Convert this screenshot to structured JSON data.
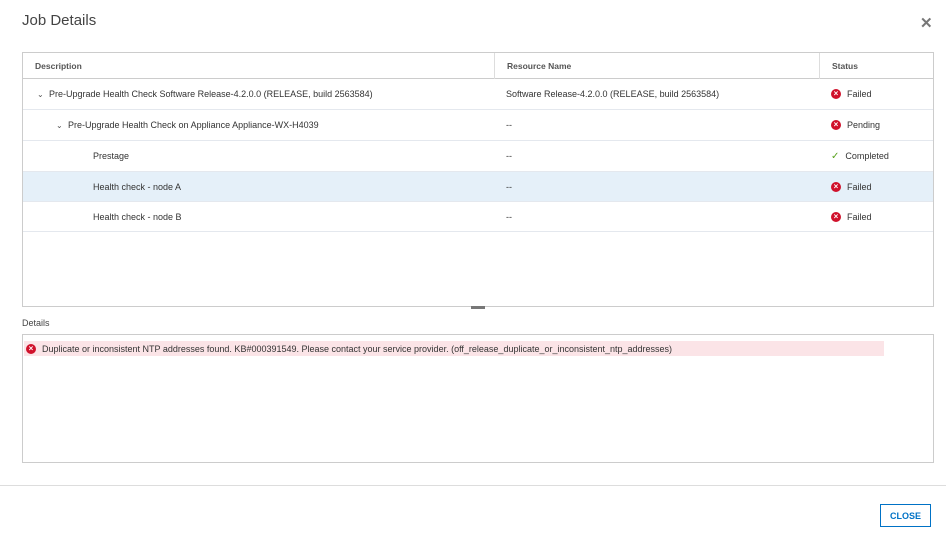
{
  "dialog": {
    "title": "Job Details",
    "close_icon": "close-icon"
  },
  "table": {
    "headers": [
      "Description",
      "Resource Name",
      "Status"
    ],
    "rows": [
      {
        "description": "Pre-Upgrade Health Check Software Release-4.2.0.0 (RELEASE, build 2563584)",
        "resource": "Software Release-4.2.0.0 (RELEASE, build 2563584)",
        "status": "Failed"
      },
      {
        "description": "Pre-Upgrade Health Check on Appliance Appliance-WX-H4039",
        "resource": "--",
        "status": "Pending"
      },
      {
        "description": "Prestage",
        "resource": "--",
        "status": "Completed"
      },
      {
        "description": "Health check - node A",
        "resource": "--",
        "status": "Failed"
      },
      {
        "description": "Health check - node B",
        "resource": "--",
        "status": "Failed"
      }
    ]
  },
  "details": {
    "label": "Details",
    "message": "Duplicate or inconsistent NTP addresses found. KB#000391549. Please contact your service provider. (off_release_duplicate_or_inconsistent_ntp_addresses)"
  },
  "footer": {
    "close_label": "CLOSE"
  },
  "colors": {
    "error": "#d0112b",
    "success": "#5aa220",
    "accent": "#0072c6",
    "selected_row": "#e5f0f9"
  }
}
